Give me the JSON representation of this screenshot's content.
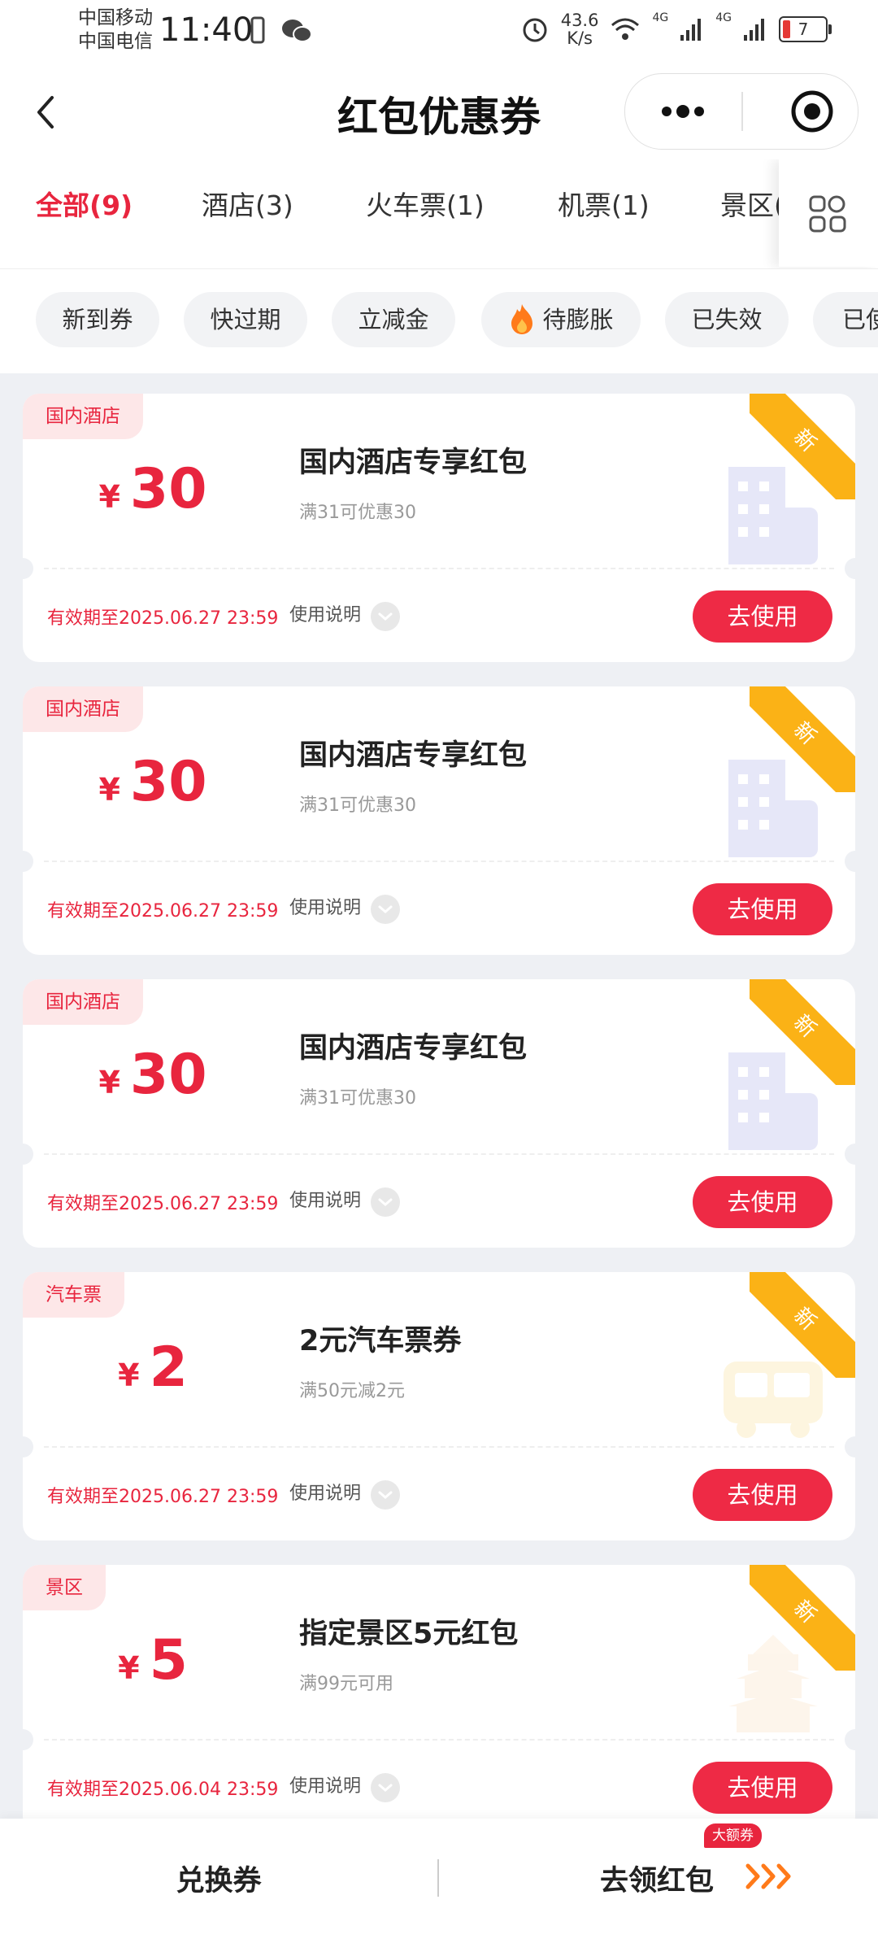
{
  "status_bar": {
    "carrier_1": "中国移动",
    "carrier_2": "中国电信",
    "time": "11:40",
    "net_speed_value": "43.6",
    "net_speed_unit": "K/s",
    "signal_1": "4G",
    "signal_2": "4G",
    "battery": "7"
  },
  "header": {
    "title": "红包优惠券"
  },
  "tabs": [
    {
      "label": "全部(9)",
      "active": true
    },
    {
      "label": "酒店(3)"
    },
    {
      "label": "火车票(1)"
    },
    {
      "label": "机票(1)"
    },
    {
      "label": "景区("
    }
  ],
  "filters": [
    "新到券",
    "快过期",
    "立减金",
    "待膨胀",
    "已失效",
    "已使"
  ],
  "coupons": [
    {
      "category": "国内酒店",
      "currency": "¥",
      "amount": "30",
      "title": "国内酒店专享红包",
      "condition": "满31可优惠30",
      "validity": "有效期至2025.06.27 23:59",
      "help": "使用说明",
      "action": "去使用",
      "ribbon": "新",
      "icon": "hotel-building-icon"
    },
    {
      "category": "国内酒店",
      "currency": "¥",
      "amount": "30",
      "title": "国内酒店专享红包",
      "condition": "满31可优惠30",
      "validity": "有效期至2025.06.27 23:59",
      "help": "使用说明",
      "action": "去使用",
      "ribbon": "新",
      "icon": "hotel-building-icon"
    },
    {
      "category": "国内酒店",
      "currency": "¥",
      "amount": "30",
      "title": "国内酒店专享红包",
      "condition": "满31可优惠30",
      "validity": "有效期至2025.06.27 23:59",
      "help": "使用说明",
      "action": "去使用",
      "ribbon": "新",
      "icon": "hotel-building-icon"
    },
    {
      "category": "汽车票",
      "currency": "¥",
      "amount": "2",
      "title": "2元汽车票券",
      "condition": "满50元减2元",
      "validity": "有效期至2025.06.27 23:59",
      "help": "使用说明",
      "action": "去使用",
      "ribbon": "新",
      "icon": "bus-icon"
    },
    {
      "category": "景区",
      "currency": "¥",
      "amount": "5",
      "title": "指定景区5元红包",
      "condition": "满99元可用",
      "validity": "有效期至2025.06.04 23:59",
      "help": "使用说明",
      "action": "去使用",
      "ribbon": "新",
      "icon": "temple-icon"
    }
  ],
  "bottom_bar": {
    "exchange_label": "兑换券",
    "get_label": "去领红包",
    "badge": "大额券"
  },
  "colors": {
    "accent": "#e8253e",
    "button": "#ee2a45",
    "ribbon": "#fbb216"
  }
}
